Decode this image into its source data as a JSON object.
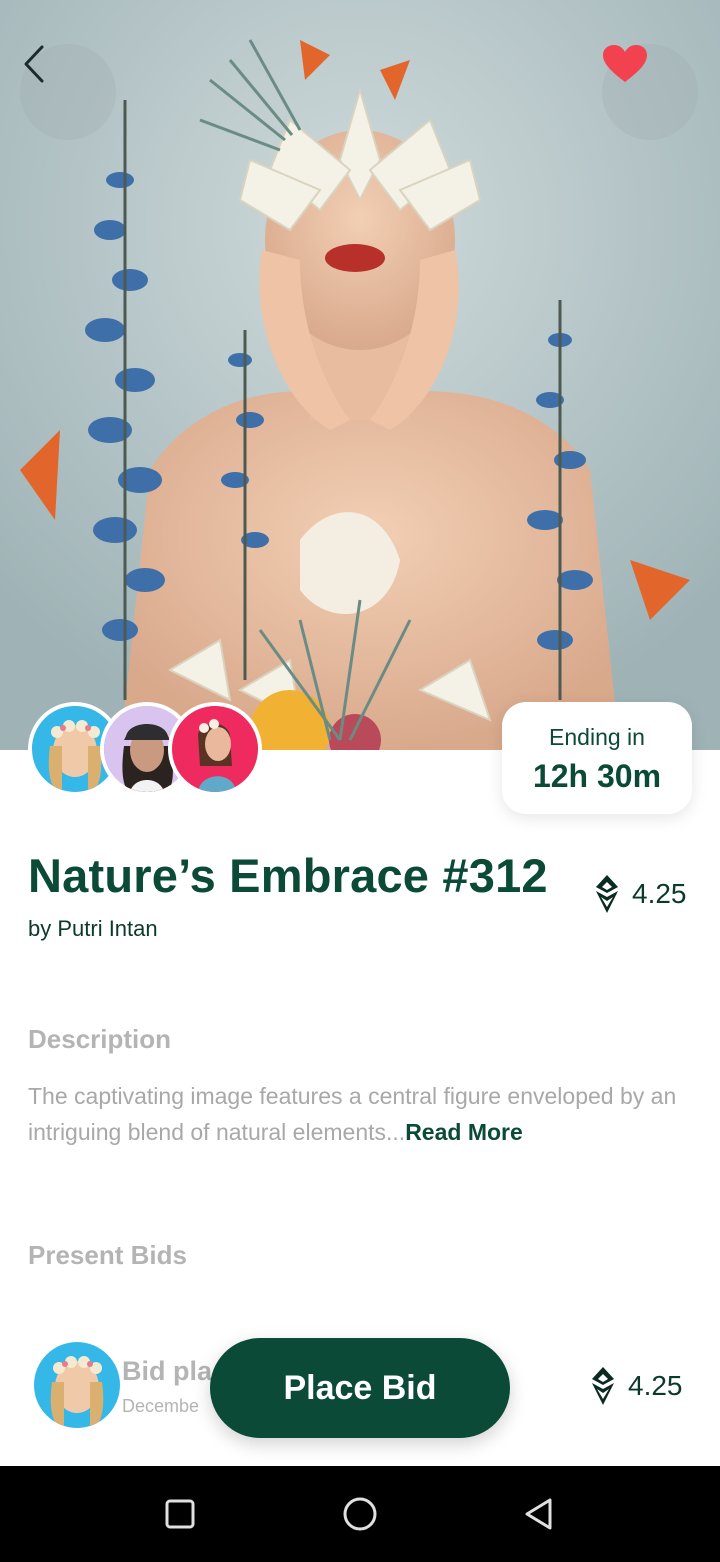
{
  "artwork": {
    "title": "Nature’s Embrace #312",
    "author": "by Putri Intan",
    "price": "4.25",
    "colors": {
      "accent": "#0b4a36",
      "favorite": "#f2424f"
    }
  },
  "header": {
    "back_icon": "chevron-left-icon",
    "favorite_icon": "heart-icon"
  },
  "auction": {
    "ending_label": "Ending in",
    "ending_time": "12h 30m"
  },
  "description": {
    "heading": "Description",
    "text": "The captivating image features a central figure enveloped by an intriguing blend of natural elements...",
    "read_more": "Read More"
  },
  "bids": {
    "heading": "Present Bids",
    "items": [
      {
        "title": "Bid pla",
        "date": "Decembe",
        "price": "4.25"
      }
    ]
  },
  "actions": {
    "place_bid": "Place Bid"
  },
  "system_nav": {
    "recent_icon": "square-icon",
    "home_icon": "circle-icon",
    "back_icon": "triangle-back-icon"
  }
}
